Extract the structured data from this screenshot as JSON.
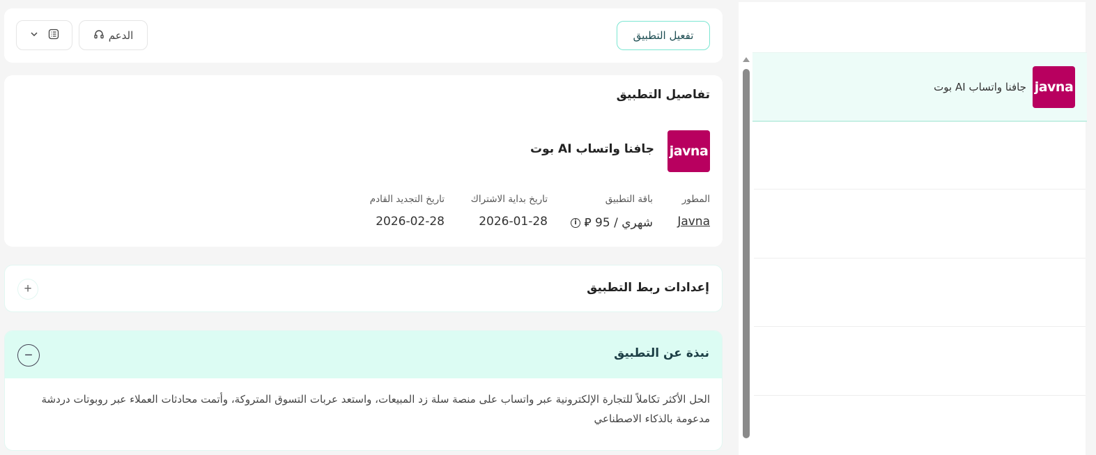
{
  "header": {
    "activate_label": "تفعيل التطبيق",
    "support_label": "الدعم"
  },
  "details": {
    "title": "تفاصيل التطبيق",
    "logo_text": "javna",
    "app_name": "جافنا واتساب AI بوت",
    "developer_label": "المطور",
    "developer_value": "Javna",
    "plan_label": "باقة التطبيق",
    "plan_value": "شهري / 95 ⃁",
    "start_label": "تاريخ بداية الاشتراك",
    "start_value": "2026-01-28",
    "renewal_label": "تاريخ التجديد القادم",
    "renewal_value": "2026-02-28"
  },
  "linking": {
    "title": "إعدادات ربط التطبيق"
  },
  "about": {
    "title": "نبذة عن التطبيق",
    "text": "الحل الأكثر تكاملاً للتجارة الإلكترونية عبر واتساب على منصة سلة زد المبيعات، واستعد عربات التسوق المتروكة، وأتمت محادثات العملاء عبر روبوتات دردشة مدعومة بالذكاء الاصطناعي"
  },
  "sidebar_list": {
    "items": [
      {
        "logo_text": "javna",
        "name": "جافنا واتساب AI بوت"
      }
    ]
  },
  "colors": {
    "brand": "#b8005f",
    "accent": "#7ce6d2",
    "about_header_bg": "#dcfcf3"
  }
}
